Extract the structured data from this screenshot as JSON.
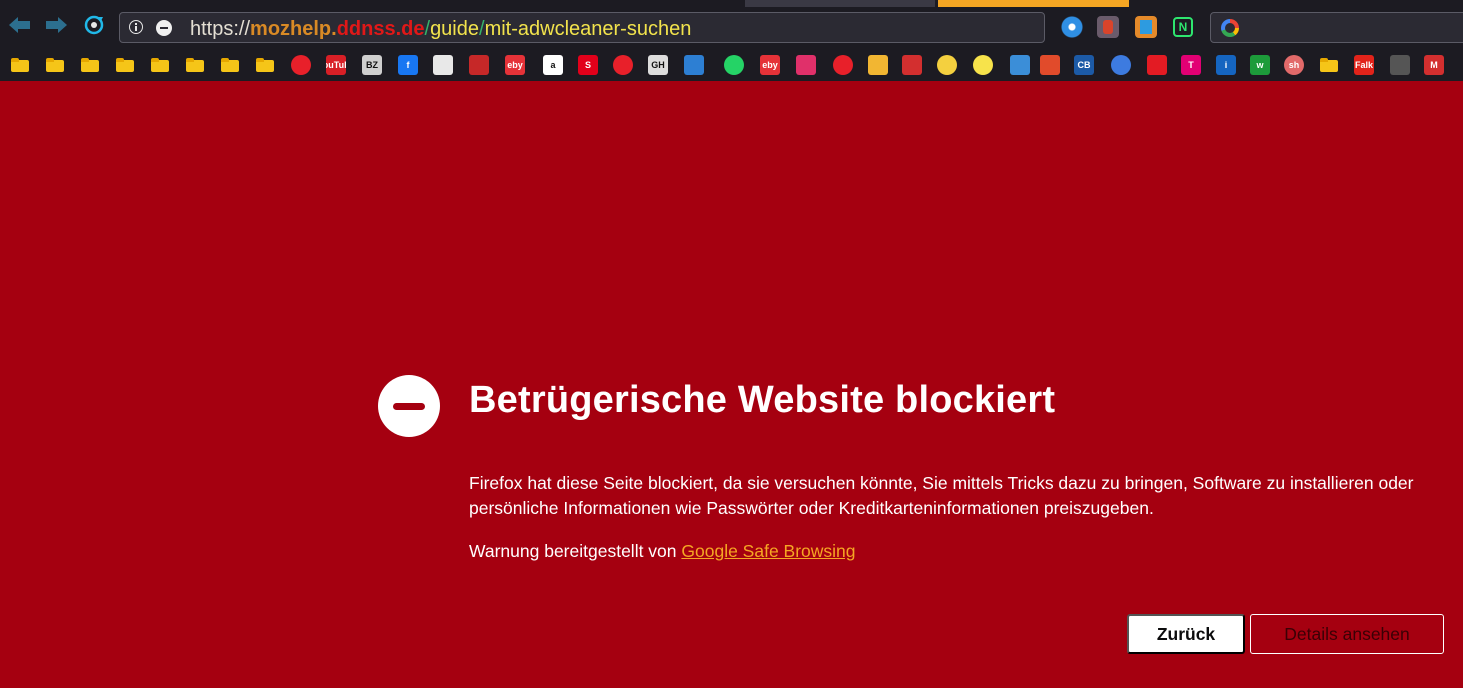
{
  "toolbar": {
    "back_icon": "arrow-left-icon",
    "forward_icon": "arrow-right-icon",
    "reload_icon": "reload-icon"
  },
  "urlbar": {
    "protocol": "https://",
    "domain": "mozhelp.",
    "domain_tld": "ddnss.de",
    "sep1": "/",
    "path1": "guide",
    "sep2": "/",
    "path2": "mit-adwcleaner-suchen",
    "colors": {
      "domain": "#d98a25",
      "tld": "#e01818",
      "separator": "#35b36b",
      "path": "#f2e34c"
    }
  },
  "extensions": [
    {
      "name": "bubble-extension-icon"
    },
    {
      "name": "addon-extension-icon"
    },
    {
      "name": "bookmark-extension-icon"
    },
    {
      "name": "n-extension-icon",
      "label": "N"
    }
  ],
  "bookmarks": [
    {
      "icon": "folder-icon"
    },
    {
      "icon": "folder-icon"
    },
    {
      "icon": "folder-icon"
    },
    {
      "icon": "folder-icon"
    },
    {
      "icon": "folder-icon"
    },
    {
      "icon": "folder-icon"
    },
    {
      "icon": "folder-icon"
    },
    {
      "icon": "folder-icon"
    },
    {
      "icon": "fire-icon",
      "color": "#e8202a"
    },
    {
      "icon": "youtube-icon",
      "label": "YouTube",
      "color": "#d81f26"
    },
    {
      "icon": "bz-icon",
      "label": "BZ",
      "color": "#cfcfcf"
    },
    {
      "icon": "facebook-icon",
      "label": "f",
      "color": "#1877f2"
    },
    {
      "icon": "circle-icon",
      "color": "#e8e8e8"
    },
    {
      "icon": "news-icon",
      "color": "#c62828"
    },
    {
      "icon": "ebay-icon",
      "label": "eby",
      "color": "#e53238"
    },
    {
      "icon": "amazon-icon",
      "label": "a",
      "color": "#ffffff"
    },
    {
      "icon": "sparkasse-icon",
      "label": "S",
      "color": "#e2001a"
    },
    {
      "icon": "fire-icon",
      "color": "#e8202a"
    },
    {
      "icon": "gh-icon",
      "label": "GH",
      "color": "#dddddd"
    },
    {
      "icon": "monitor-icon",
      "color": "#2d7fd3"
    },
    {
      "icon": "whatsapp-icon",
      "color": "#25d366"
    },
    {
      "icon": "ebay-icon",
      "label": "eby",
      "color": "#e53238"
    },
    {
      "icon": "cloud-icon",
      "color": "#e0306a"
    },
    {
      "icon": "fire-icon",
      "color": "#e8202a"
    },
    {
      "icon": "people-icon",
      "color": "#f2b632"
    },
    {
      "icon": "mail-icon",
      "color": "#d32f2f"
    },
    {
      "icon": "smiley-icon",
      "color": "#f4d03f"
    },
    {
      "icon": "smiley-icon",
      "color": "#f7e34b"
    },
    {
      "icon": "landscape-icon",
      "color": "#3b8ed8"
    },
    {
      "icon": "car-icon",
      "color": "#e14b2b"
    },
    {
      "icon": "cb-icon",
      "label": "CB",
      "color": "#1c5aa6"
    },
    {
      "icon": "map-pin-icon",
      "color": "#3d7be0"
    },
    {
      "icon": "check-icon",
      "color": "#e31b23"
    },
    {
      "icon": "telekom-icon",
      "label": "T",
      "color": "#e20074"
    },
    {
      "icon": "info-icon",
      "label": "i",
      "color": "#1565c0"
    },
    {
      "icon": "w-icon",
      "label": "w",
      "color": "#1d9b3a"
    },
    {
      "icon": "sh-icon",
      "label": "sh",
      "color": "#e26a6a"
    },
    {
      "icon": "folder-icon"
    },
    {
      "icon": "falk-icon",
      "label": "Falk",
      "color": "#e2231a"
    },
    {
      "icon": "pen-icon",
      "color": "#555555"
    },
    {
      "icon": "m-icon",
      "label": "M",
      "color": "#d32f2f"
    }
  ],
  "error": {
    "icon": "blocked-icon",
    "title": "Betrügerische Website blockiert",
    "description": "Firefox hat diese Seite blockiert, da sie versuchen könnte, Sie mittels Tricks dazu zu bringen, Software zu installieren oder persönliche Informationen wie Passwörter oder Kreditkarteninformationen preiszugeben.",
    "provider_prefix": "Warnung bereitgestellt von ",
    "provider_link": "Google Safe Browsing",
    "back_button": "Zurück",
    "details_button": "Details ansehen",
    "background_color": "#a50010",
    "link_color": "#f5a623"
  }
}
